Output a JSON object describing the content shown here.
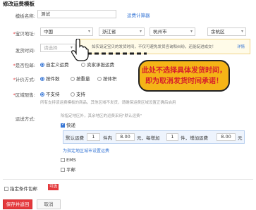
{
  "page_title": "修改运费模板",
  "template_name": {
    "label": "模板名称:",
    "value": "测试",
    "link": "运费计算器"
  },
  "ship_from": {
    "label": "宝贝地址:",
    "country": "中国",
    "province": "浙江省",
    "city": "杭州市",
    "district": "余杭区"
  },
  "ship_time": {
    "label": "发货时间:",
    "placeholder": "请选择",
    "notice": "如实设定宝贝的发货时间，不仅可避免发货咨询和纠纷，还能促进成交！",
    "notice_link": "详情"
  },
  "free_shipping": {
    "label": "是否包邮:",
    "options": [
      "自定义运费",
      "卖家承担运费"
    ]
  },
  "pricing": {
    "label": "计价方式:",
    "options": [
      "按件数",
      "按重量",
      "按体积"
    ]
  },
  "area_limit": {
    "label": "区域限售:",
    "options": [
      "不支持",
      "支持"
    ],
    "hint": "所有支持该运费模板的商品，其他区域不发货，请确保运费区域设置正确后启用"
  },
  "delivery": {
    "label": "运送方式:",
    "hint": "除指定地区外，其余地区的运费采用\"默认运费\"",
    "express": "快递",
    "row": {
      "prefix": "默认运费",
      "first_qty": "1",
      "unit1": "件内",
      "first_fee": "8.00",
      "unit2": "元，",
      "mid": "每增加",
      "add_qty": "1",
      "unit3": "件，增加运费",
      "add_fee": "8.00",
      "unit4": "元"
    },
    "area_link": "为指定地区城市设置运费",
    "ems": "EMS",
    "mail": "平邮"
  },
  "conditional_free": {
    "label": "指定条件包邮",
    "badge": "可选"
  },
  "buttons": {
    "save": "保存并返回",
    "cancel": "取消"
  },
  "callout": {
    "line1": "此处不选择具体发货时间，",
    "line2": "即为取消发货时间承诺！"
  },
  "colors": {
    "accent": "#3a78d6",
    "required": "#e4393c",
    "primary_button": "#e4393c",
    "callout_bg": "#f5b417",
    "callout_text": "#d8202a",
    "badge": "#e4393c"
  }
}
